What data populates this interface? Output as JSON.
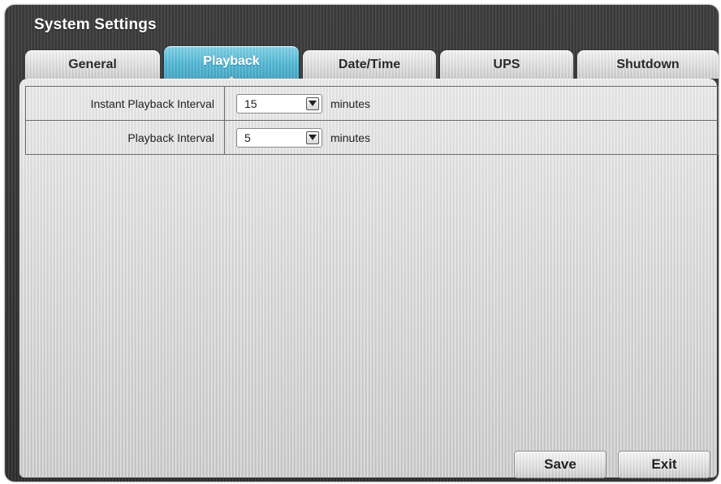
{
  "window": {
    "title": "System Settings"
  },
  "tabs": [
    {
      "label": "General",
      "active": false
    },
    {
      "label": "Playback",
      "active": true
    },
    {
      "label": "Date/Time",
      "active": false
    },
    {
      "label": "UPS",
      "active": false
    },
    {
      "label": "Shutdown",
      "active": false
    }
  ],
  "settings": [
    {
      "label": "Instant Playback Interval",
      "value": "15",
      "unit": "minutes"
    },
    {
      "label": "Playback Interval",
      "value": "5",
      "unit": "minutes"
    }
  ],
  "buttons": {
    "save": "Save",
    "exit": "Exit"
  },
  "colors": {
    "active_tab": "#4fb4d2",
    "window_frame": "#333333",
    "panel": "#d9d9d9"
  },
  "icons": {
    "dropdown": "chevron-down-icon"
  }
}
